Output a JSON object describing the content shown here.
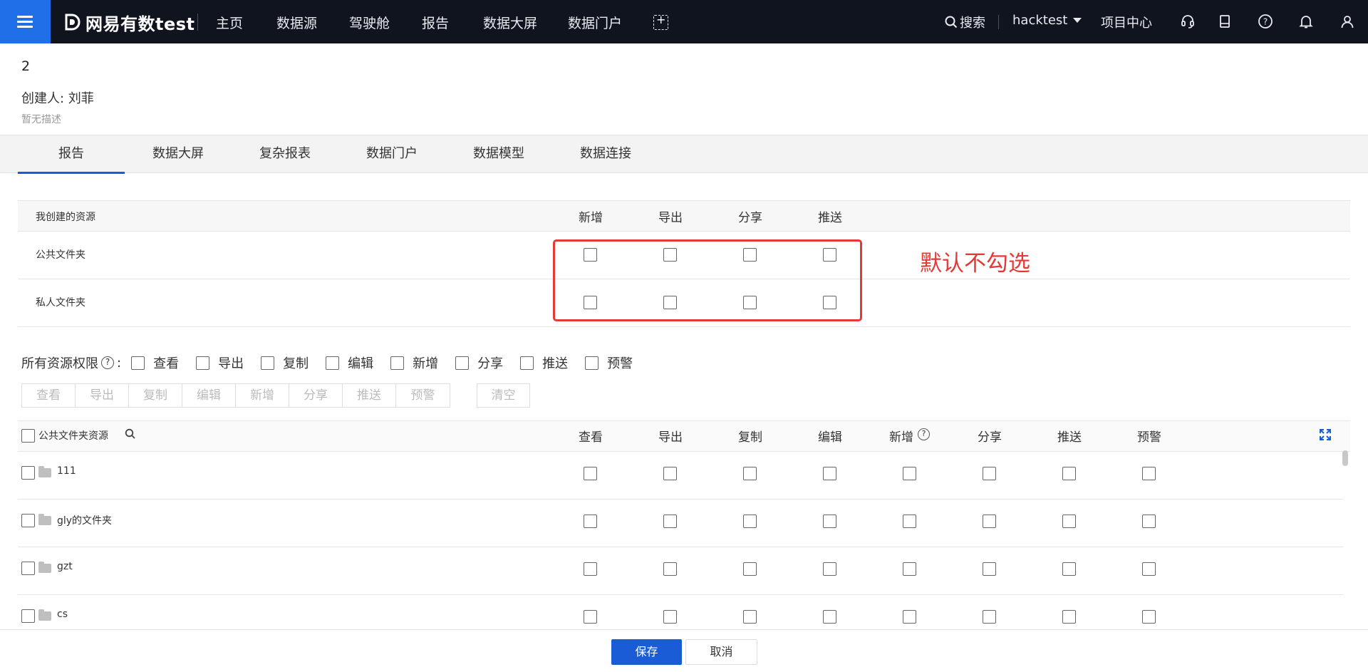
{
  "nav": {
    "logo": "网易有数test",
    "items": [
      "主页",
      "数据源",
      "驾驶舱",
      "报告",
      "数据大屏",
      "数据门户"
    ],
    "search": "搜索",
    "user": "hacktest",
    "project_center": "项目中心",
    "icons": [
      "headset-icon",
      "bookmark-icon",
      "help-icon",
      "bell-icon",
      "user-icon"
    ]
  },
  "header": {
    "title": "2",
    "creator": "创建人:  刘菲",
    "description": "暂无描述"
  },
  "tabs": [
    "报告",
    "数据大屏",
    "复杂报表",
    "数据门户",
    "数据模型",
    "数据连接"
  ],
  "active_tab": "报告",
  "my_resources": {
    "header": "我创建的资源",
    "columns": [
      "新增",
      "导出",
      "分享",
      "推送"
    ],
    "rows": [
      "公共文件夹",
      "私人文件夹"
    ],
    "annotation": "默认不勾选",
    "annotation_color": "#e53935"
  },
  "all_permissions": {
    "label": "所有资源权限",
    "help": "?",
    "colon": ":",
    "options": [
      "查看",
      "导出",
      "复制",
      "编辑",
      "新增",
      "分享",
      "推送",
      "预警"
    ],
    "buttons": [
      "查看",
      "导出",
      "复制",
      "编辑",
      "新增",
      "分享",
      "推送",
      "预警"
    ],
    "clear": "清空"
  },
  "public_resources": {
    "header": "公共文件夹资源",
    "columns": [
      "查看",
      "导出",
      "复制",
      "编辑",
      "新增",
      "分享",
      "推送",
      "预警"
    ],
    "rows": [
      "111",
      "gly的文件夹",
      "gzt",
      "cs"
    ]
  },
  "footer": {
    "save": "保存",
    "cancel": "取消"
  },
  "colors": {
    "primary": "#1a5bd6",
    "nav_bg": "#10141f",
    "menu_bg": "#1f6fe8"
  }
}
